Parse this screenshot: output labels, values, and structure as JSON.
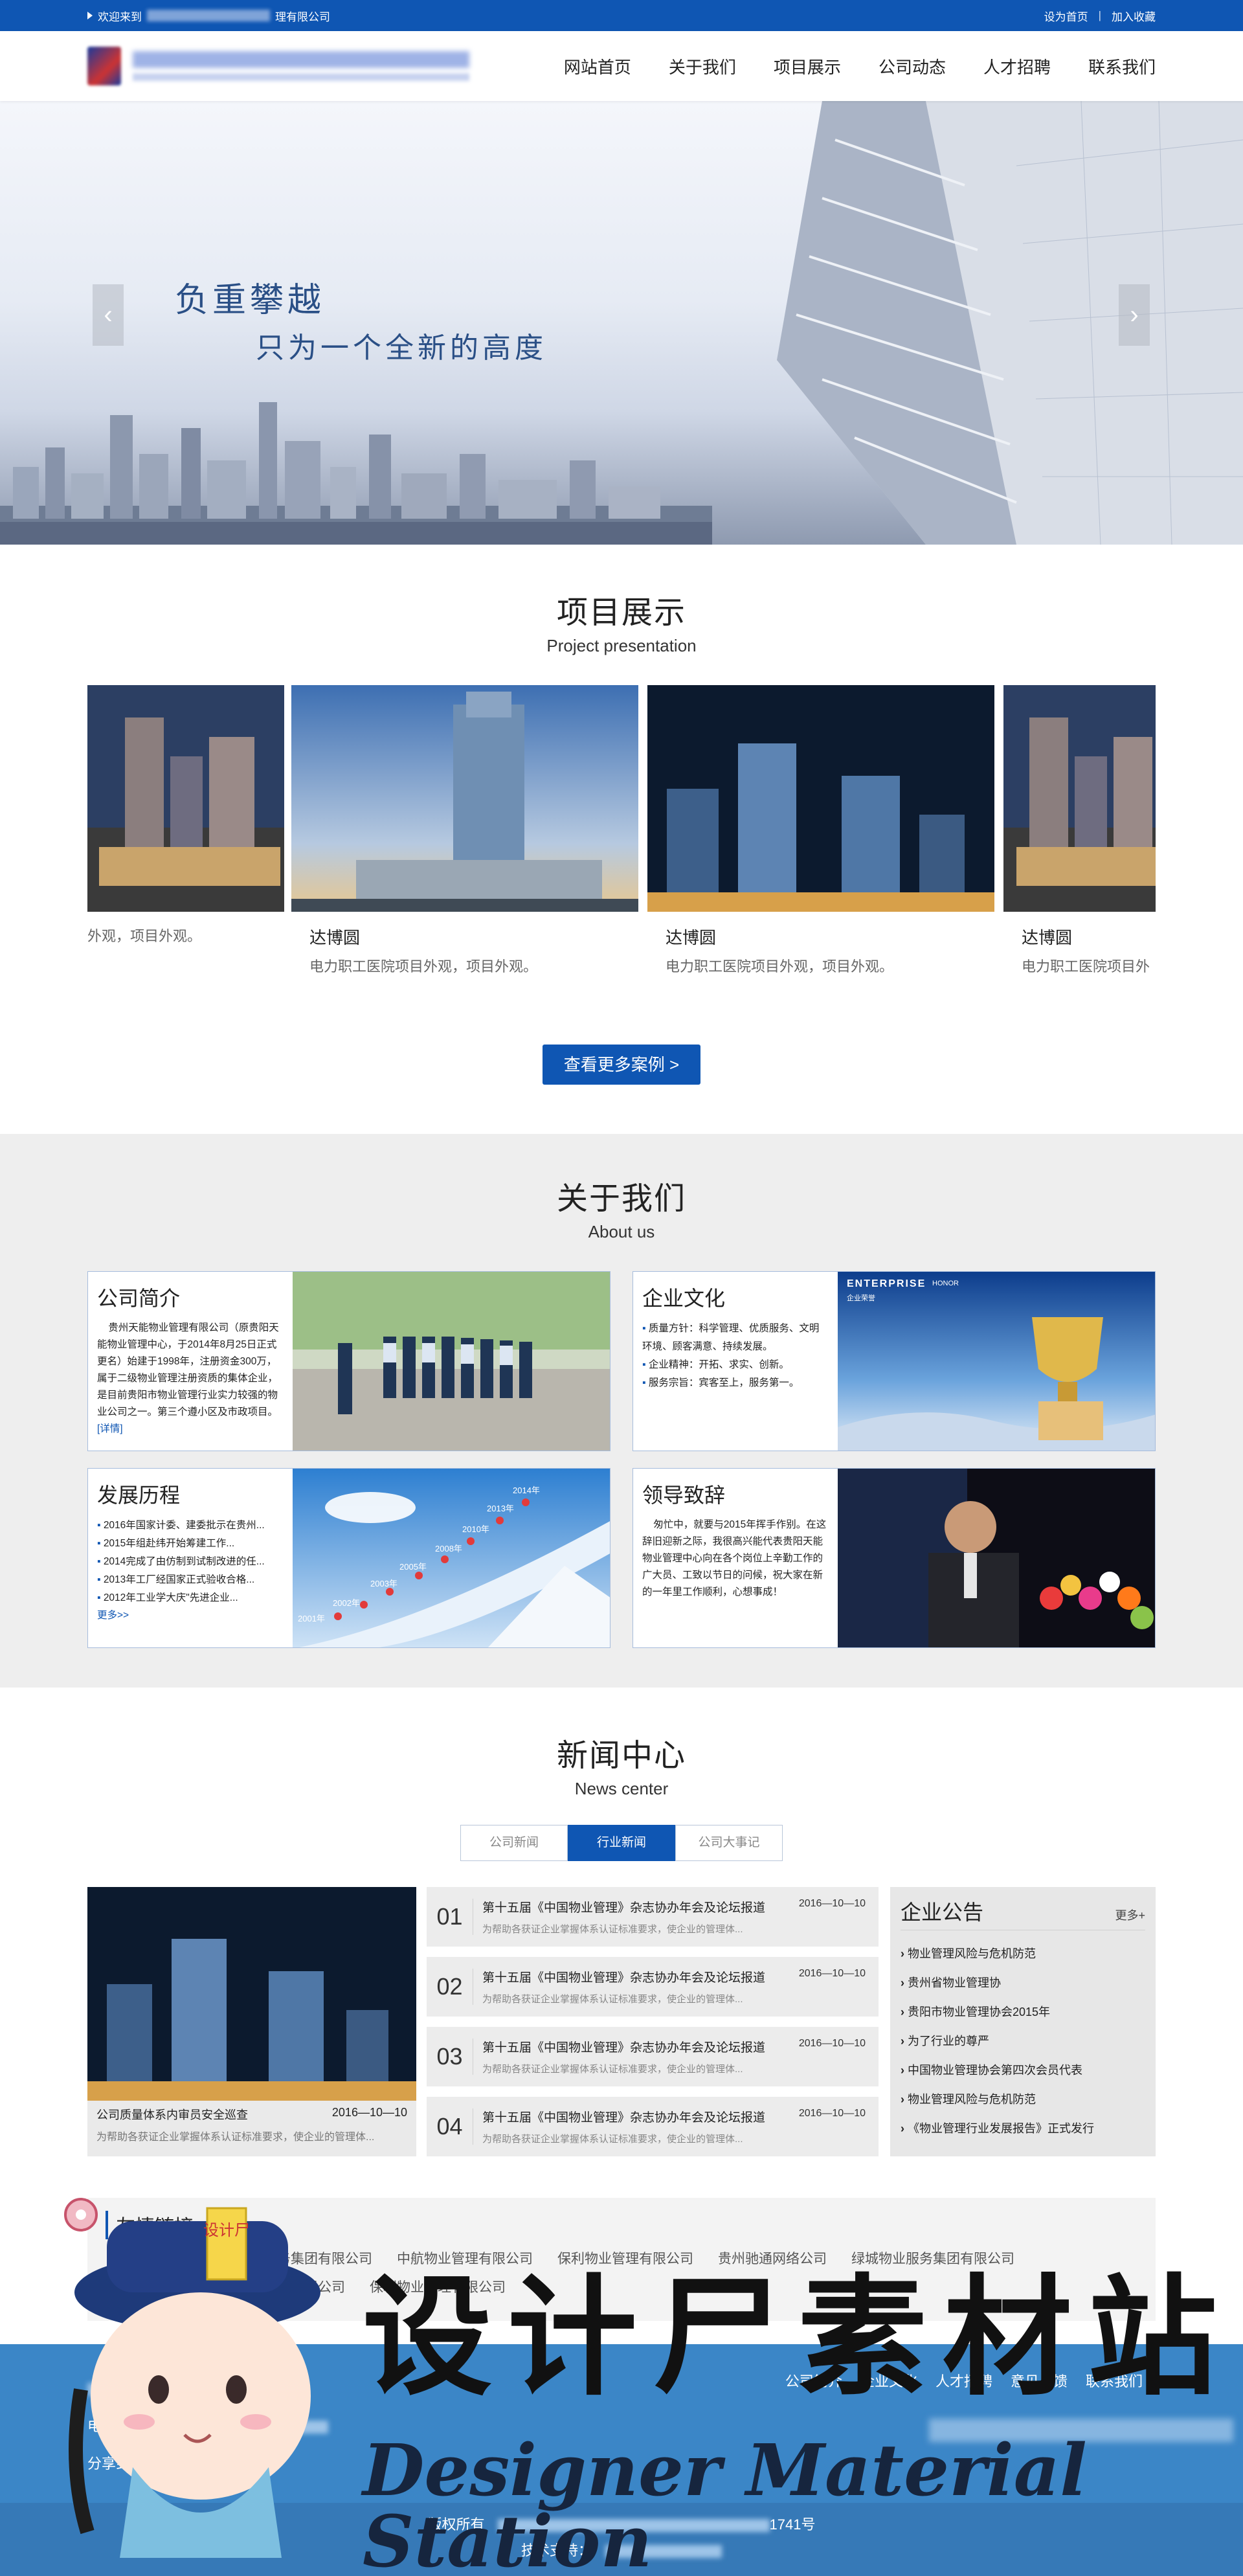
{
  "topbar": {
    "welcome_prefix": "欢迎来到",
    "welcome_suffix": "理有限公司",
    "set_home": "设为首页",
    "separator": "|",
    "add_fav": "加入收藏"
  },
  "nav": [
    "网站首页",
    "关于我们",
    "项目展示",
    "公司动态",
    "人才招聘",
    "联系我们"
  ],
  "banner": {
    "slogan_1": "负重攀越",
    "slogan_2": "只为一个全新的高度",
    "prev_icon": "‹",
    "next_icon": "›"
  },
  "projects": {
    "title": "项目展示",
    "subtitle": "Project presentation",
    "items": [
      {
        "name": "",
        "desc": "外观，项目外观。"
      },
      {
        "name": "达博圆",
        "desc": "电力职工医院项目外观，项目外观。"
      },
      {
        "name": "达博圆",
        "desc": "电力职工医院项目外观，项目外观。"
      },
      {
        "name": "达博圆",
        "desc": "电力职工医院项目外"
      }
    ],
    "more_button": "查看更多案例 >"
  },
  "about": {
    "title": "关于我们",
    "subtitle": "About us",
    "intro": {
      "title": "公司简介",
      "body": "贵州天能物业管理有限公司（原贵阳天能物业管理中心，于2014年8月25日正式更名）始建于1998年，注册资金300万，属于二级物业管理注册资质的集体企业，是目前贵阳市物业管理行业实力较强的物业公司之一。第三个遵小区及市政项目。",
      "link": "[详情]"
    },
    "culture": {
      "title": "企业文化",
      "items": [
        "质量方针：科学管理、优质服务、文明环境、顾客满意、持续发展。",
        "企业精神：开拓、求实、创新。",
        "服务宗旨：宾客至上，服务第一。"
      ],
      "enterprise_label": "ENTERPRISE",
      "honor_label": "HONOR",
      "honor_cn": "企业荣誉"
    },
    "history": {
      "title": "发展历程",
      "items": [
        "2016年国家计委、建委批示在贵州...",
        "2015年组赴纬开始筹建工作...",
        "2014完成了由仿制到试制改进的任...",
        "2013年工厂经国家正式验收合格...",
        "2012年工业学大庆\"先进企业..."
      ],
      "more": "更多>>",
      "years": [
        "2001年",
        "2002年",
        "2003年",
        "2005年",
        "2008年",
        "2010年",
        "2013年",
        "2014年"
      ]
    },
    "leader": {
      "title": "领导致辞",
      "body": "匆忙中，就要与2015年挥手作别。在这辞旧迎新之际，我很高兴能代表贵阳天能物业管理中心向在各个岗位上辛勤工作的广大员、工致以节日的问候，祝大家在新的一年里工作顺利，心想事成！"
    }
  },
  "news": {
    "title": "新闻中心",
    "subtitle": "News center",
    "tabs": [
      "公司新闻",
      "行业新闻",
      "公司大事记"
    ],
    "active_tab": "行业新闻",
    "feature": {
      "title": "公司质量体系内审员安全巡查",
      "date": "2016—10—10",
      "desc": "为帮助各获证企业掌握体系认证标准要求，使企业的管理体..."
    },
    "items": [
      {
        "num": "01",
        "title": "第十五届《中国物业管理》杂志协办年会及论坛报道",
        "date": "2016—10—10",
        "desc": "为帮助各获证企业掌握体系认证标准要求，使企业的管理体..."
      },
      {
        "num": "02",
        "title": "第十五届《中国物业管理》杂志协办年会及论坛报道",
        "date": "2016—10—10",
        "desc": "为帮助各获证企业掌握体系认证标准要求，使企业的管理体..."
      },
      {
        "num": "03",
        "title": "第十五届《中国物业管理》杂志协办年会及论坛报道",
        "date": "2016—10—10",
        "desc": "为帮助各获证企业掌握体系认证标准要求，使企业的管理体..."
      },
      {
        "num": "04",
        "title": "第十五届《中国物业管理》杂志协办年会及论坛报道",
        "date": "2016—10—10",
        "desc": "为帮助各获证企业掌握体系认证标准要求，使企业的管理体..."
      }
    ],
    "notice": {
      "title": "企业公告",
      "more": "更多+",
      "items": [
        "物业管理风险与危机防范",
        "贵州省物业管理协",
        "贵阳市物业管理协会2015年",
        "为了行业的尊严",
        "中国物业管理协会第四次会员代表",
        "物业管理风险与危机防范",
        "《物业管理行业发展报告》正式发行"
      ]
    }
  },
  "friends": {
    "title": "友情链接",
    "links": [
      "杭城物业服务集团有限公司",
      "中航物业管理有限公司",
      "保利物业管理有限公司",
      "贵州驰通网络公司",
      "绿城物业服务集团有限公司",
      "中航物业管理有限公司",
      "保利物业管理有限公司"
    ]
  },
  "footer": {
    "links": [
      "公司简介",
      "企业文化",
      "人才招聘",
      "意见反馈",
      "联系我们"
    ],
    "tel_label": "电 话：",
    "share_label": "分享到：",
    "copyright_prefix": "版权所有",
    "copyright_suffix": "1741号",
    "tech_label": "技术支持："
  },
  "watermark": {
    "cn": "设计尸素材站",
    "en": "Designer Material Station",
    "badge": "设计尸"
  },
  "colors": {
    "primary": "#0f56b3",
    "footer": "#3b86c7",
    "gray_bg": "#eeeeee"
  }
}
